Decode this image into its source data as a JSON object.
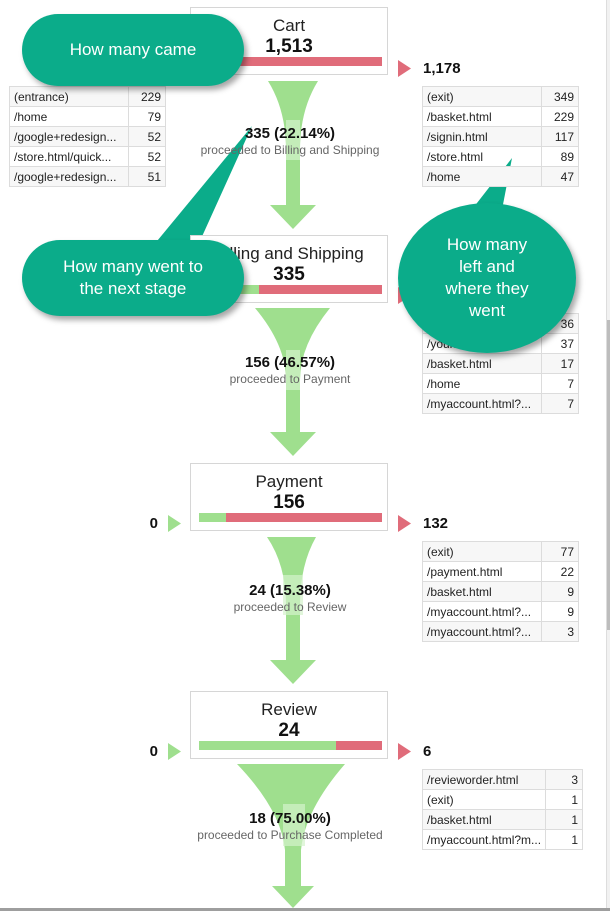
{
  "stages": [
    {
      "name": "Cart",
      "count": "1,513",
      "entries": null,
      "continued_fraction": 0.0,
      "exits": "1,178",
      "entry_sources": [
        {
          "page": "(entrance)",
          "count": "229"
        },
        {
          "page": "/home",
          "count": "79"
        },
        {
          "page": "/google+redesign...",
          "count": "52"
        },
        {
          "page": "/store.html/quick...",
          "count": "52"
        },
        {
          "page": "/google+redesign...",
          "count": "51"
        }
      ],
      "exit_destinations": [
        {
          "page": "(exit)",
          "count": "349"
        },
        {
          "page": "/basket.html",
          "count": "229"
        },
        {
          "page": "/signin.html",
          "count": "117"
        },
        {
          "page": "/store.html",
          "count": "89"
        },
        {
          "page": "/home",
          "count": "47"
        }
      ],
      "conversion": {
        "value": "335 (22.14%)",
        "text": "proceeded to Billing and Shipping"
      }
    },
    {
      "name": "Billing and Shipping",
      "count": "335",
      "entries": null,
      "continued_fraction": 0.33,
      "exits": "",
      "exit_destinations": [
        {
          "page": "",
          "count": "36"
        },
        {
          "page": "/yourinfo.html",
          "count": "37"
        },
        {
          "page": "/basket.html",
          "count": "17"
        },
        {
          "page": "/home",
          "count": "7"
        },
        {
          "page": "/myaccount.html?...",
          "count": "7"
        }
      ],
      "conversion": {
        "value": "156 (46.57%)",
        "text": "proceeded to Payment"
      }
    },
    {
      "name": "Payment",
      "count": "156",
      "entries": "0",
      "continued_fraction": 0.15,
      "exits": "132",
      "exit_destinations": [
        {
          "page": "(exit)",
          "count": "77"
        },
        {
          "page": "/payment.html",
          "count": "22"
        },
        {
          "page": "/basket.html",
          "count": "9"
        },
        {
          "page": "/myaccount.html?...",
          "count": "9"
        },
        {
          "page": "/myaccount.html?...",
          "count": "3"
        }
      ],
      "conversion": {
        "value": "24 (15.38%)",
        "text": "proceeded to Review"
      }
    },
    {
      "name": "Review",
      "count": "24",
      "entries": "0",
      "continued_fraction": 0.75,
      "exits": "6",
      "exit_destinations": [
        {
          "page": "/revieworder.html",
          "count": "3"
        },
        {
          "page": "(exit)",
          "count": "1"
        },
        {
          "page": "/basket.html",
          "count": "1"
        },
        {
          "page": "/myaccount.html?m...",
          "count": "1"
        }
      ],
      "conversion": {
        "value": "18 (75.00%)",
        "text": "proceeded to Purchase Completed"
      }
    }
  ],
  "callouts": {
    "came": "How many came",
    "went": "How many went to the next stage",
    "left": "How many left and where they went"
  },
  "colors": {
    "continue_green": "#9fdf8e",
    "exit_red": "#e06c7a",
    "callout_teal": "#0bac8a"
  }
}
